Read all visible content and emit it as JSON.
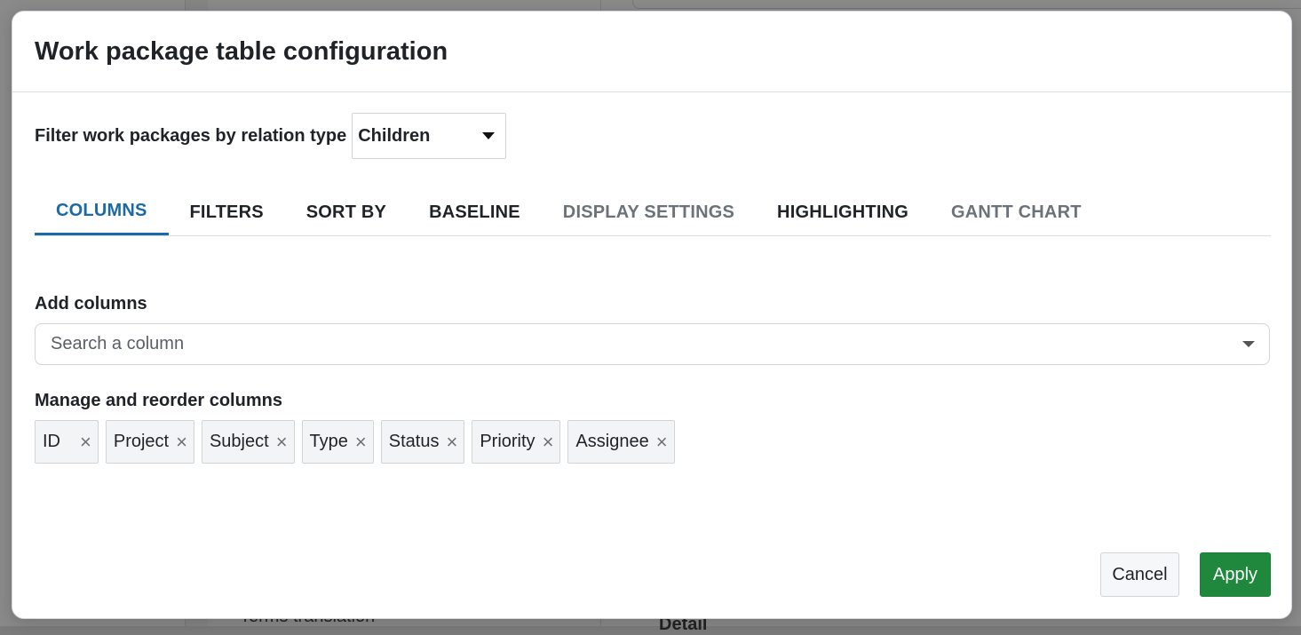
{
  "background": {
    "text_left": "Terms translation",
    "text_right": "Detail"
  },
  "modal": {
    "title": "Work package table configuration"
  },
  "relation_filter": {
    "label": "Filter work packages by relation type",
    "selected": "Children"
  },
  "tabs": [
    {
      "label": "COLUMNS",
      "state": "active"
    },
    {
      "label": "FILTERS",
      "state": "normal"
    },
    {
      "label": "SORT BY",
      "state": "normal"
    },
    {
      "label": "BASELINE",
      "state": "normal"
    },
    {
      "label": "DISPLAY SETTINGS",
      "state": "muted"
    },
    {
      "label": "HIGHLIGHTING",
      "state": "normal"
    },
    {
      "label": "GANTT CHART",
      "state": "muted"
    }
  ],
  "add_columns": {
    "label": "Add columns",
    "placeholder": "Search a column"
  },
  "manage_columns": {
    "label": "Manage and reorder columns",
    "columns": [
      "ID",
      "Project",
      "Subject",
      "Type",
      "Status",
      "Priority",
      "Assignee"
    ],
    "remove_glyph": "×"
  },
  "buttons": {
    "cancel": "Cancel",
    "apply": "Apply"
  },
  "colors": {
    "accent": "#1b6aa4",
    "apply_green": "#1f883d"
  }
}
